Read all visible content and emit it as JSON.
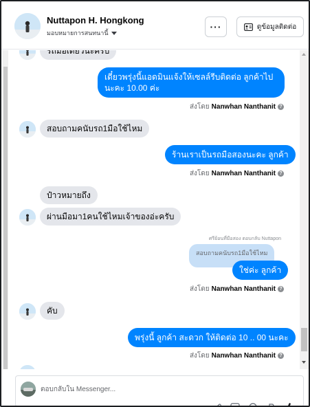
{
  "header": {
    "name": "Nuttapon H. Hongkong",
    "assign_label": "มอบหมายการสนทนานี้",
    "more_label": "···",
    "contact_label": "ดูข้อมูลติดต่อ"
  },
  "messages": {
    "partial_top": "รถมือเดียวนะครับ",
    "m1_text": "เดี๋ยวพรุ่งนี้แอดมินแจ้งให้เซลล์รีบติดต่อ ลูกค้าไปนะคะ 10.00 ค่ะ",
    "m2_text": "สอบถามคนับรถ1มือใช้ไหม",
    "m3_text": "ร้านเราเป็นรถมือสองนะคะ ลูกค้า",
    "m4_text": "ป๋าวหมายถึง",
    "m5_text": "ผ่านมือมา1คนใช้ไหมเจ้าของอ่ะครับ",
    "reply_label": "ศรีย้อนที่มือสอง ตอบกลับ Nuttapon",
    "quoted_text": "สอบถามคนับรถ1มือใช้ไหม",
    "m6_text": "ใช่ค่ะ ลูกค้า",
    "m7_text": "คับ",
    "m8_text": "พรุ่งนี้ ลูกค้า สะดวก ให้ติดต่อ 10 .. 00 นะคะ",
    "sent_prefix": "ส่งโดย",
    "sender": "Nanwhan Nanthanit"
  },
  "composer": {
    "placeholder": "ตอบกลับใน Messenger..."
  },
  "colors": {
    "outgoing": "#0084ff",
    "incoming": "#e4e6eb"
  }
}
